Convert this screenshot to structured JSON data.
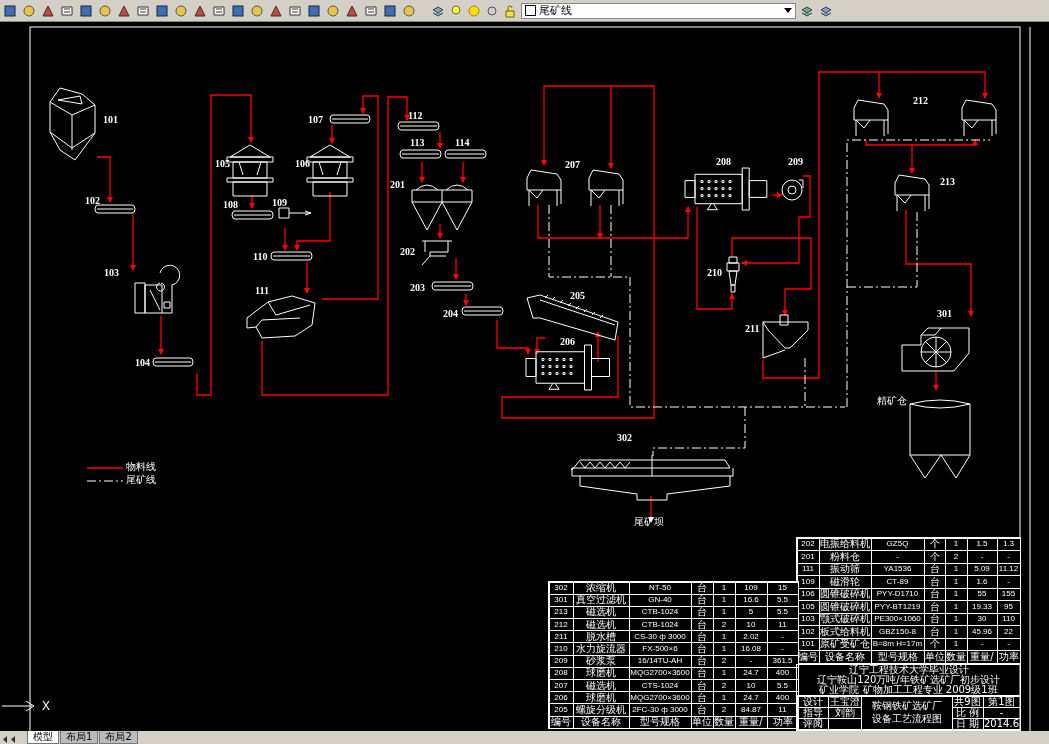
{
  "toolbar": {
    "layer_name": "尾矿线"
  },
  "diagram": {
    "labels": [
      {
        "text": "101"
      },
      {
        "text": "102"
      },
      {
        "text": "103"
      },
      {
        "text": "104"
      },
      {
        "text": "105"
      },
      {
        "text": "106"
      },
      {
        "text": "107"
      },
      {
        "text": "108"
      },
      {
        "text": "109"
      },
      {
        "text": "110"
      },
      {
        "text": "111"
      },
      {
        "text": "112"
      },
      {
        "text": "113"
      },
      {
        "text": "114"
      },
      {
        "text": "201"
      },
      {
        "text": "202"
      },
      {
        "text": "203"
      },
      {
        "text": "204"
      },
      {
        "text": "205"
      },
      {
        "text": "206"
      },
      {
        "text": "207"
      },
      {
        "text": "208"
      },
      {
        "text": "209"
      },
      {
        "text": "210"
      },
      {
        "text": "211"
      },
      {
        "text": "212"
      },
      {
        "text": "213"
      },
      {
        "text": "301"
      },
      {
        "text": "302"
      },
      {
        "text": "精矿仓"
      },
      {
        "text": "尾矿坝"
      }
    ],
    "legend": [
      {
        "kind": "material",
        "label": "物料线"
      },
      {
        "kind": "tailings",
        "label": "尾矿线"
      }
    ]
  },
  "equipment_table_right": {
    "rows": [
      [
        "202",
        "电振给料机",
        "GZ5Q",
        "个",
        "1",
        "1.5",
        "1.3"
      ],
      [
        "201",
        "粉料仓",
        "-",
        "个",
        "2",
        "-",
        "-"
      ],
      [
        "111",
        "振动筛",
        "YA1536",
        "台",
        "1",
        "5.09",
        "11.12"
      ],
      [
        "109",
        "磁滑轮",
        "CT-89",
        "台",
        "1",
        "1.6",
        "-"
      ],
      [
        "106",
        "圆锥破碎机",
        "PYY-D1710",
        "台",
        "1",
        "55",
        "155"
      ],
      [
        "105",
        "圆锥破碎机",
        "PYY-BT1219",
        "台",
        "1",
        "19.33",
        "95"
      ],
      [
        "103",
        "颚式破碎机",
        "PE300×1060",
        "台",
        "1",
        "30",
        "110"
      ],
      [
        "102",
        "板式给料机",
        "GBZ150-8",
        "台",
        "1",
        "45.96",
        "22"
      ],
      [
        "101",
        "原矿受矿仓",
        "B=8m H=17m",
        "个",
        "1",
        "-",
        "-"
      ]
    ],
    "header": [
      "编号",
      "设备名称",
      "型号规格",
      "单位",
      "数量",
      "重量/",
      "功率"
    ]
  },
  "equipment_table_left": {
    "rows": [
      [
        "302",
        "浓缩机",
        "NT-50",
        "台",
        "1",
        "109",
        "15"
      ],
      [
        "301",
        "真空过滤机",
        "GN-40",
        "台",
        "1",
        "16.6",
        "5.5"
      ],
      [
        "213",
        "磁选机",
        "CTB-1024",
        "台",
        "1",
        "5",
        "5.5"
      ],
      [
        "212",
        "磁选机",
        "CTB-1024",
        "台",
        "2",
        "10",
        "11"
      ],
      [
        "211",
        "脱水槽",
        "CS-30 ф 3000",
        "台",
        "1",
        "2.02",
        "-"
      ],
      [
        "210",
        "水力旋流器",
        "FX-500×6",
        "台",
        "1",
        "16.08",
        "-"
      ],
      [
        "209",
        "砂浆泵",
        "16/14TU-AH",
        "台",
        "2",
        "-",
        "361.5"
      ],
      [
        "208",
        "球磨机",
        "MQG2700×3600",
        "台",
        "1",
        "24.7",
        "400"
      ],
      [
        "207",
        "磁选机",
        "CTS-1024",
        "台",
        "2",
        "10",
        "5.5"
      ],
      [
        "206",
        "球磨机",
        "MQG2700×3600",
        "台",
        "1",
        "24.7",
        "400"
      ],
      [
        "205",
        "螺旋分级机",
        "2FC-30 ф 3000",
        "台",
        "2",
        "84.87",
        "11"
      ]
    ],
    "header": [
      "编号",
      "设备名称",
      "型号规格",
      "单位",
      "数量",
      "重量/",
      "功率"
    ]
  },
  "title_block": {
    "lines": [
      "辽宁工程技术大学毕业设计",
      "辽宁鞍山120万吨/年铁矿选矿厂初步设计",
      "矿业学院 矿物加工工程专业 2009级1班"
    ],
    "roles": [
      {
        "label": "设计",
        "name": "王宝澄"
      },
      {
        "label": "指导",
        "name": "刘韵"
      },
      {
        "label": "评阅"
      }
    ],
    "drawing_title": [
      "鞍钢铁矿选矿厂",
      "设备工艺流程图"
    ],
    "info": [
      [
        "共9图",
        "第1图"
      ],
      [
        "比 例",
        "-"
      ],
      [
        "日 期",
        "2014.6"
      ]
    ]
  },
  "ucs_icon": {
    "axis_label": "X"
  },
  "layout_tabs": [
    {
      "label": "模型",
      "selected": true
    },
    {
      "label": "布局1",
      "selected": false
    },
    {
      "label": "布局2",
      "selected": false
    }
  ]
}
